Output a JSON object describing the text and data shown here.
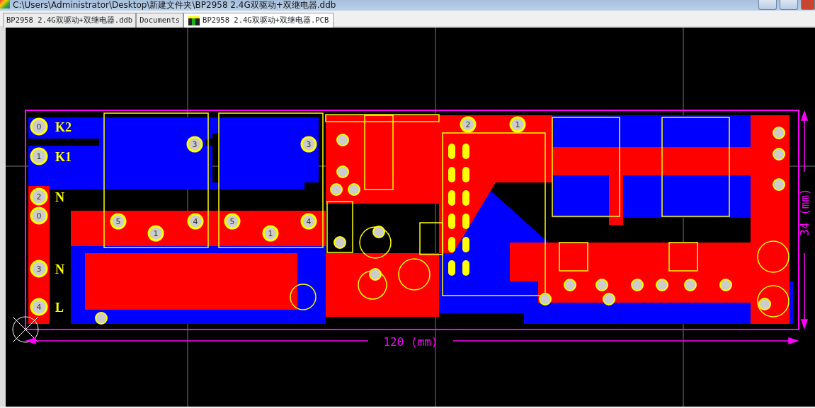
{
  "window": {
    "title": "C:\\Users\\Administrator\\Desktop\\新建文件夹\\BP2958 2.4G双驱动+双继电器.ddb"
  },
  "tabs": [
    {
      "label": "BP2958 2.4G双驱动+双继电器.ddb",
      "selected": false,
      "kind": "plain"
    },
    {
      "label": "Documents",
      "selected": false,
      "kind": "plain"
    },
    {
      "label": "BP2958 2.4G双驱动+双继电器.PCB",
      "selected": true,
      "kind": "pcb"
    }
  ],
  "board": {
    "connectors": [
      {
        "pad": "0",
        "label": "K2"
      },
      {
        "pad": "1",
        "label": "K1"
      },
      {
        "pad": "2",
        "label": "N"
      },
      {
        "pad": "0"
      },
      {
        "pad": "3",
        "label": "N"
      },
      {
        "pad": "4",
        "label": "L"
      }
    ],
    "pads": [
      "3",
      "3",
      "5",
      "4",
      "1",
      "5",
      "4",
      "1",
      "2",
      "1"
    ],
    "dimensions": {
      "width": "120 (mm)",
      "height": "34 (mm)"
    }
  }
}
